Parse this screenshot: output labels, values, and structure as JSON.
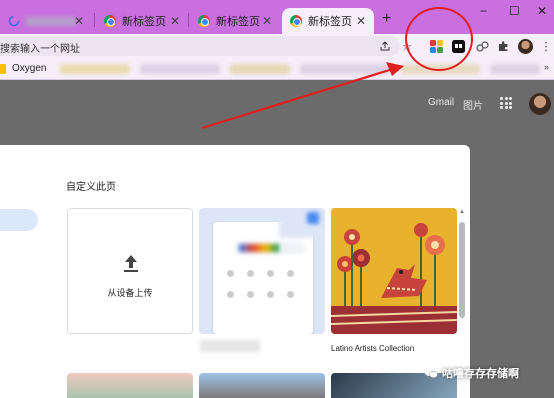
{
  "tabs": [
    {
      "label": "",
      "active": false
    },
    {
      "label": "新标签页",
      "active": false
    },
    {
      "label": "新标签页",
      "active": false
    },
    {
      "label": "新标签页",
      "active": true
    }
  ],
  "new_tab_symbol": "+",
  "window_controls": {
    "minimize": "−",
    "maximize": "☐",
    "close": "✕"
  },
  "omnibox": {
    "text": "搜索输入一个网址"
  },
  "bookmarks": {
    "first_label": "Oxygen"
  },
  "ntp": {
    "gmail": "Gmail",
    "images": "图片"
  },
  "dialog": {
    "title": "自定义此页",
    "upload_label": "从设备上传",
    "art_caption": "Latino Artists Collection"
  },
  "watermark": "咕噜存存存储啊",
  "colors": {
    "tabstrip": "#c96fe0",
    "toolbar": "#f6eef9",
    "annotation": "#e02020",
    "overlay": "#6b6b6b",
    "art_bg": "#e8b22c"
  }
}
